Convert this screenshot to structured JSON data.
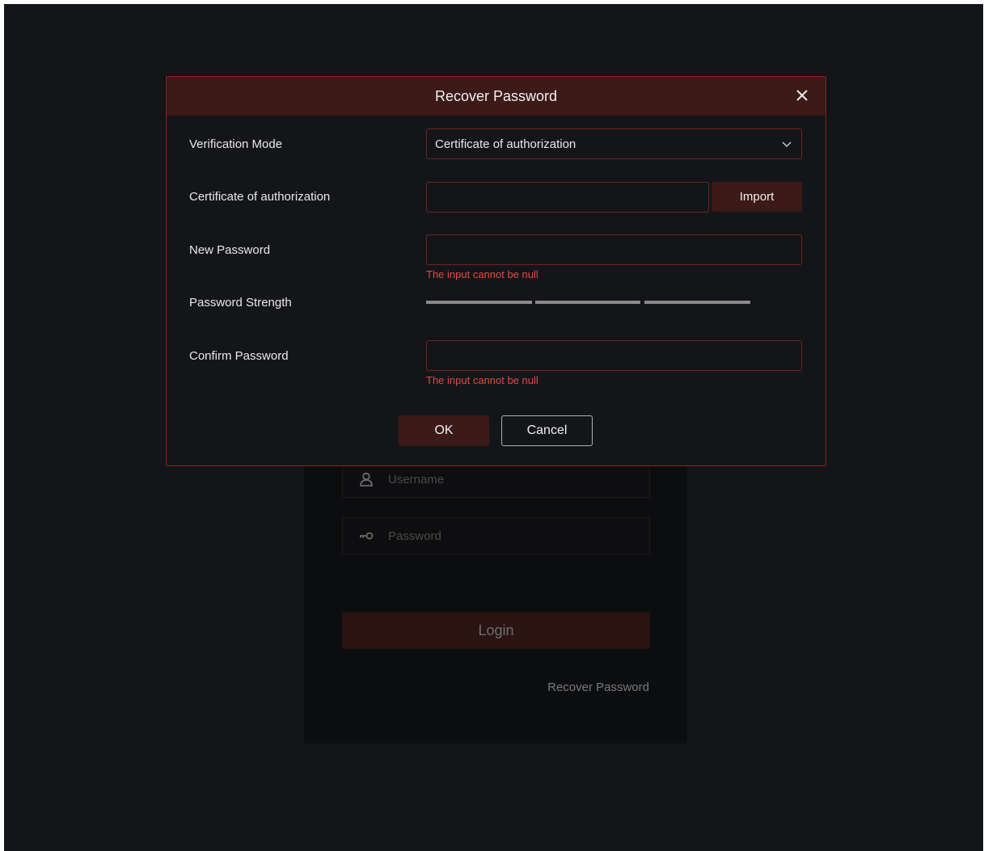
{
  "login": {
    "username_placeholder": "Username",
    "password_placeholder": "Password",
    "login_label": "Login",
    "recover_link": "Recover Password"
  },
  "dialog": {
    "title": "Recover Password",
    "fields": {
      "verification_mode_label": "Verification Mode",
      "verification_mode_value": "Certificate of authorization",
      "certificate_label": "Certificate of authorization",
      "import_label": "Import",
      "new_password_label": "New Password",
      "new_password_error": "The input cannot be null",
      "strength_label": "Password Strength",
      "confirm_password_label": "Confirm Password",
      "confirm_password_error": "The input cannot be null"
    },
    "ok_label": "OK",
    "cancel_label": "Cancel"
  },
  "icons": {
    "close": "close-icon",
    "dropdown": "chevron-down-icon",
    "user": "user-icon",
    "key": "key-icon"
  },
  "colors": {
    "background": "#141519",
    "accent": "#3b1a18",
    "border": "#8c2a22",
    "error": "#e04a44"
  }
}
